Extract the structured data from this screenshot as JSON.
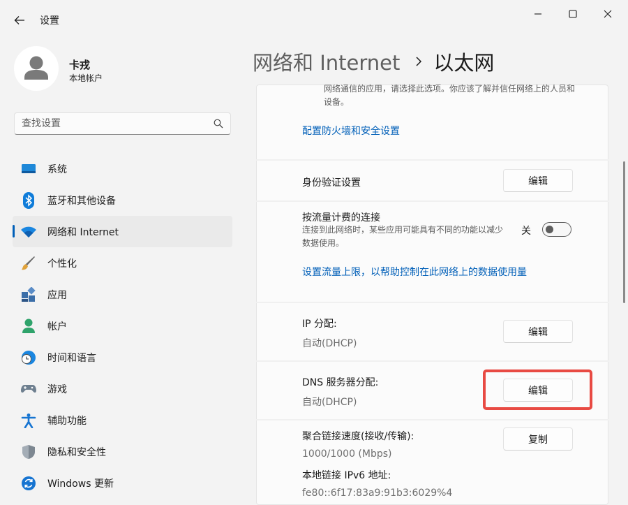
{
  "window": {
    "title": "设置",
    "controls": [
      "minimize-icon",
      "maximize-icon",
      "close-icon"
    ]
  },
  "user": {
    "name": "卡戎",
    "account_type": "本地帐户"
  },
  "search": {
    "placeholder": "查找设置",
    "value": ""
  },
  "sidebar": {
    "active_index": 2,
    "items": [
      {
        "label": "系统",
        "icon": "system-icon"
      },
      {
        "label": "蓝牙和其他设备",
        "icon": "bluetooth-icon"
      },
      {
        "label": "网络和 Internet",
        "icon": "wifi-icon"
      },
      {
        "label": "个性化",
        "icon": "brush-icon"
      },
      {
        "label": "应用",
        "icon": "apps-icon"
      },
      {
        "label": "帐户",
        "icon": "account-icon"
      },
      {
        "label": "时间和语言",
        "icon": "globe-clock-icon"
      },
      {
        "label": "游戏",
        "icon": "gamepad-icon"
      },
      {
        "label": "辅助功能",
        "icon": "accessibility-icon"
      },
      {
        "label": "隐私和安全性",
        "icon": "shield-icon"
      },
      {
        "label": "Windows 更新",
        "icon": "update-icon"
      }
    ]
  },
  "header": {
    "parent": "网络和 Internet",
    "separator": "›",
    "current": "以太网"
  },
  "content": {
    "network_profile_desc": "网络通信的应用，请选择此选项。你应该了解并信任网络上的人员和设备。",
    "firewall_link": "配置防火墙和安全设置",
    "auth": {
      "title": "身份验证设置",
      "button": "编辑"
    },
    "metered": {
      "title": "按流量计费的连接",
      "desc": "连接到此网络时，某些应用可能具有不同的功能以减少数据使用。",
      "state_label": "关",
      "on": false
    },
    "data_limit_link": "设置流量上限，以帮助控制在此网络上的数据使用量",
    "ip": {
      "title": "IP 分配:",
      "value": "自动(DHCP)",
      "button": "编辑"
    },
    "dns": {
      "title": "DNS 服务器分配:",
      "value": "自动(DHCP)",
      "button": "编辑"
    },
    "props": {
      "speed_label": "聚合链接速度(接收/传输):",
      "speed_value": "1000/1000 (Mbps)",
      "ipv6_label": "本地链接 IPv6 地址:",
      "ipv6_value": "fe80::6f17:83a9:91b3:6029%4",
      "copy_button": "复制"
    }
  },
  "colors": {
    "accent": "#005fb8",
    "highlight_box": "#e84a43",
    "background": "#f3f3f3"
  }
}
